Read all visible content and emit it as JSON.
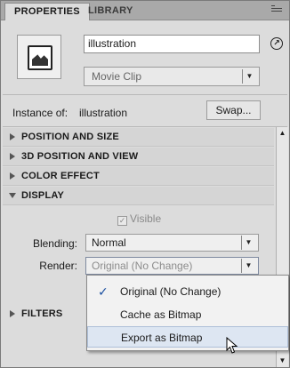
{
  "tabs": [
    {
      "label": "PROPERTIES",
      "active": true
    },
    {
      "label": "LIBRARY",
      "active": false
    }
  ],
  "header": {
    "instance_name": "illustration",
    "symbol_type": "Movie Clip",
    "instance_of_label": "Instance of:",
    "instance_of_value": "illustration",
    "swap_label": "Swap..."
  },
  "sections": {
    "position_size": "POSITION AND SIZE",
    "position_view_3d": "3D POSITION AND VIEW",
    "color_effect": "COLOR EFFECT",
    "display": "DISPLAY",
    "filters": "FILTERS"
  },
  "display": {
    "visible_label": "Visible",
    "visible_checked": true,
    "blending_label": "Blending:",
    "blending_value": "Normal",
    "render_label": "Render:",
    "render_value": "Original (No Change)"
  },
  "render_menu": {
    "items": [
      {
        "label": "Original (No Change)",
        "checked": true
      },
      {
        "label": "Cache as Bitmap",
        "checked": false
      },
      {
        "label": "Export as Bitmap",
        "checked": false,
        "hovered": true
      }
    ]
  },
  "icons": {
    "symbol": "movie-clip-symbol-icon",
    "edit": "edit-instance-icon",
    "check": "✓",
    "dropdown_arrow": "▼",
    "scroll_up": "▲",
    "scroll_down": "▼"
  }
}
